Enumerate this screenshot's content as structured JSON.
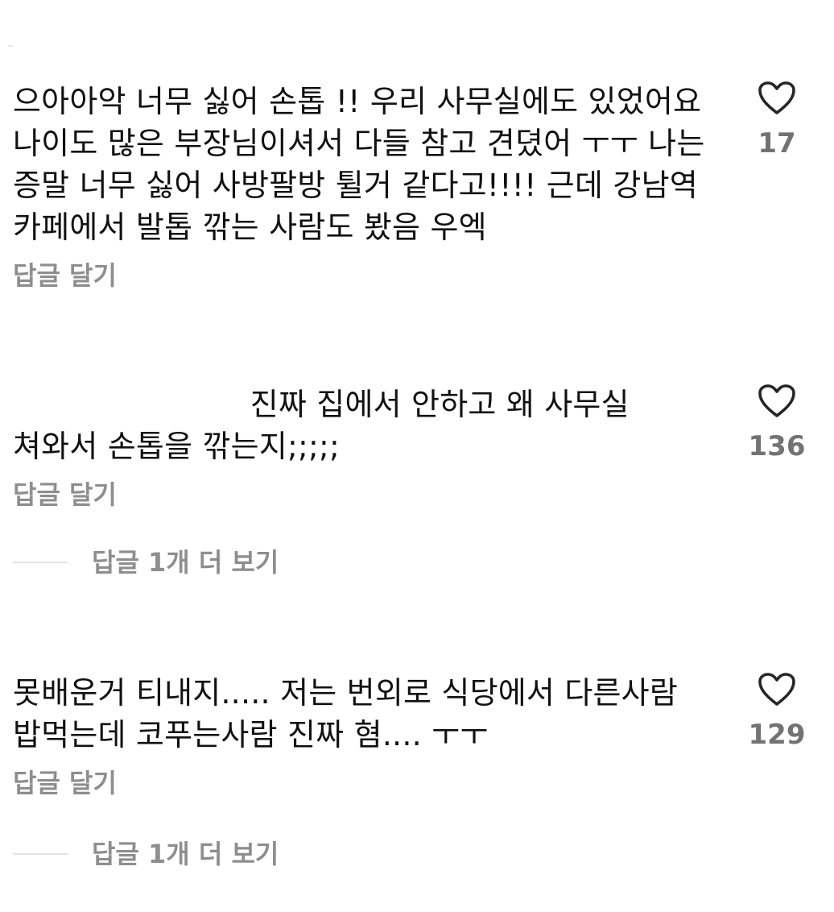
{
  "comments": [
    {
      "text": "으아아악 너무 싫어 손톱 !! 우리 사무실에도 있었어요 나이도 많은 부장님이셔서 다들 참고 견뎠어 ㅜㅜ 나는 증말 너무 싫어 사방팔방 튈거 같다고!!!! 근데 강남역 카페에서 발톱 깎는 사람도 봤음 우엑",
      "likes": "17",
      "reply_label": "답글 달기"
    },
    {
      "text": "                        진짜 집에서 안하고 왜 사무실 쳐와서 손톱을 깎는지;;;;;",
      "likes": "136",
      "reply_label": "답글 달기",
      "more_replies_label": "답글 1개 더 보기"
    },
    {
      "text": "못배운거 티내지..... 저는 번외로 식당에서 다른사람 밥먹는데 코푸는사람 진짜 혐.... ㅜㅜ",
      "likes": "129",
      "reply_label": "답글 달기",
      "more_replies_label": "답글 1개 더 보기"
    }
  ],
  "icons": {
    "like": "heart-outline-icon"
  },
  "colors": {
    "text": "#111111",
    "muted": "#8e8e8e",
    "count": "#737373",
    "divider": "#e3e3e3"
  }
}
